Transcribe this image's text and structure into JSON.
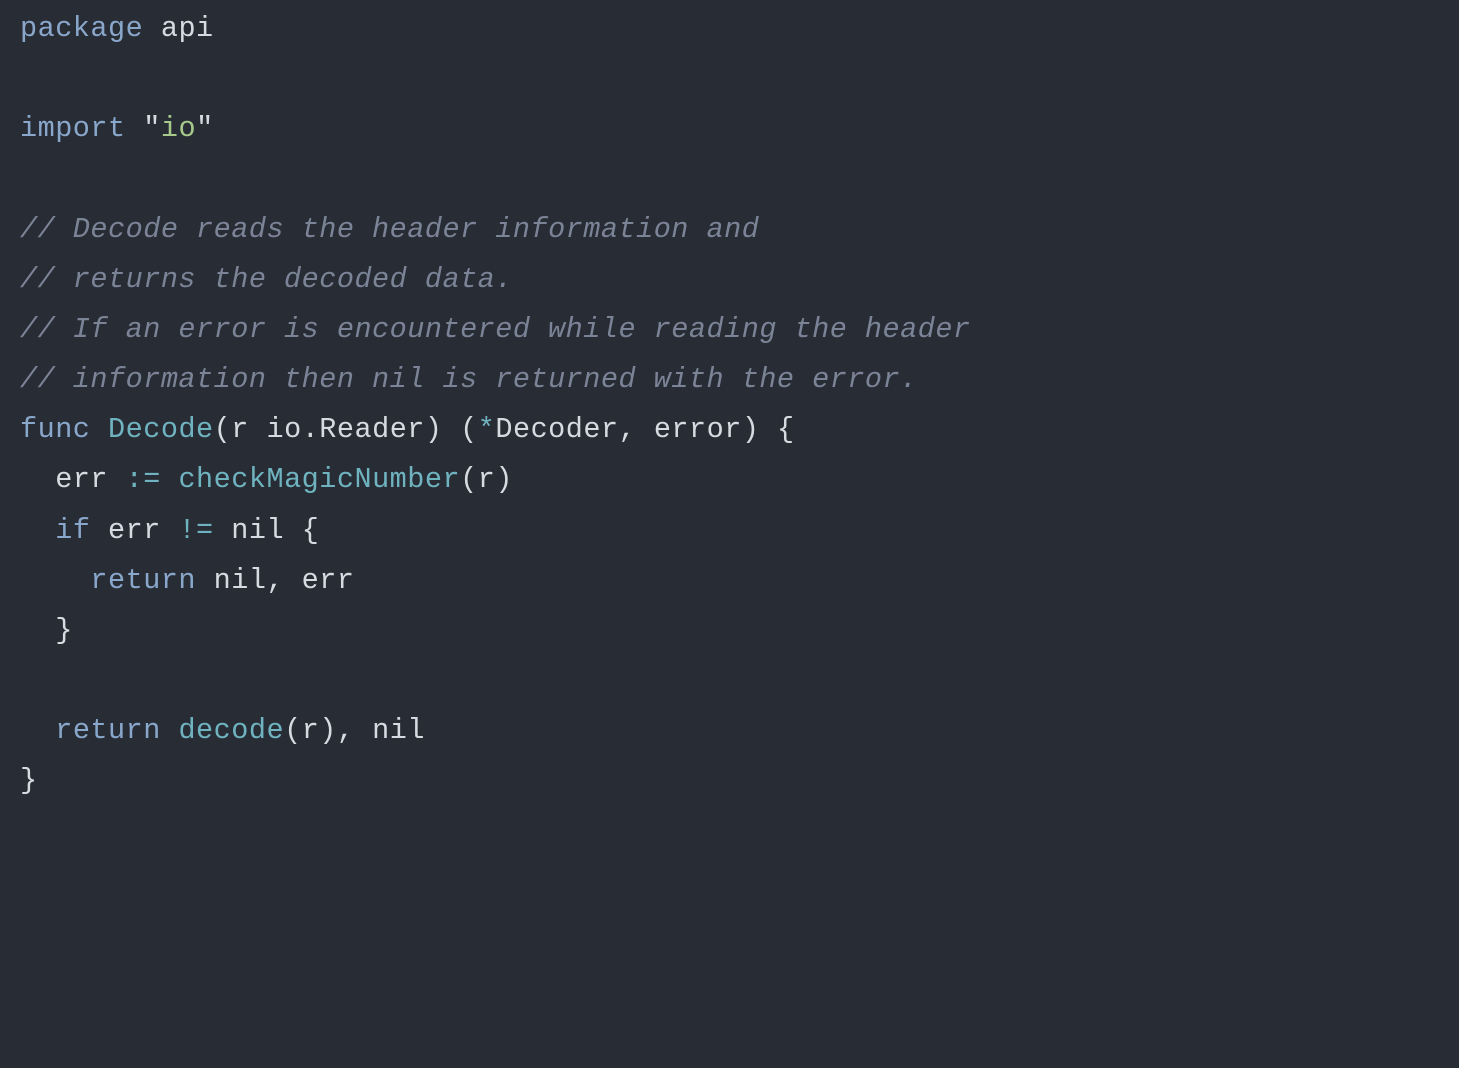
{
  "code": {
    "line1": {
      "kw": "package",
      "pkg": "api"
    },
    "line3": {
      "kw": "import",
      "q1": "\"",
      "str": "io",
      "q2": "\""
    },
    "comment1": "// Decode reads the header information and",
    "comment2": "// returns the decoded data.",
    "comment3": "// If an error is encountered while reading the header",
    "comment4": "// information then nil is returned with the error.",
    "funcline": {
      "kw": "func",
      "name": "Decode",
      "lp1": "(",
      "param": "r",
      "ptype": "io.Reader",
      "rp1": ")",
      "lp2": " (",
      "star": "*",
      "ret1": "Decoder",
      "comma": ",",
      "ret2": "error",
      "rp2": ")",
      "brace": " {"
    },
    "line_err": {
      "indent": "  ",
      "var": "err",
      "op": " := ",
      "fn": "checkMagicNumber",
      "lp": "(",
      "arg": "r",
      "rp": ")"
    },
    "line_if": {
      "indent": "  ",
      "kw": "if",
      "var": " err ",
      "op": "!=",
      "nil": " nil",
      "brace": " {"
    },
    "line_ret1": {
      "indent": "    ",
      "kw": "return",
      "nil": " nil",
      "comma": ",",
      "var": " err"
    },
    "line_close_if": {
      "indent": "  ",
      "brace": "}"
    },
    "line_ret2": {
      "indent": "  ",
      "kw": "return",
      "sp": " ",
      "fn": "decode",
      "lp": "(",
      "arg": "r",
      "rp": ")",
      "comma": ",",
      "nil": " nil"
    },
    "line_close": {
      "brace": "}"
    }
  }
}
